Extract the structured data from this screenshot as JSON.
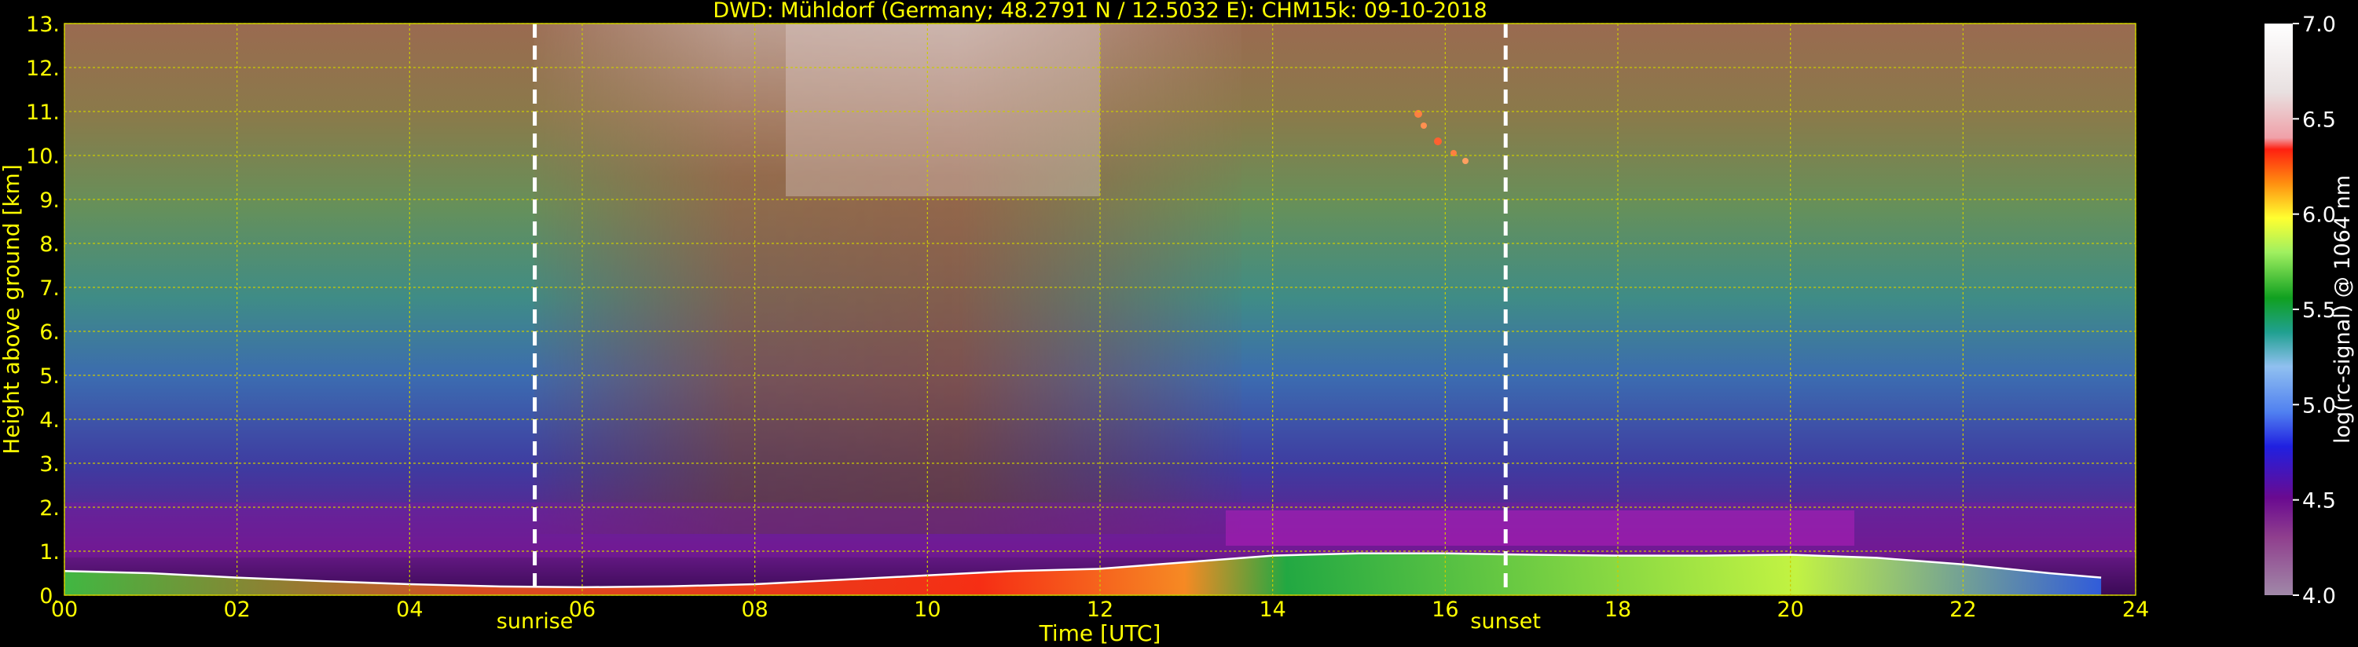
{
  "chart_data": {
    "type": "heatmap",
    "title": "DWD: Mühldorf (Germany; 48.2791 N / 12.5032 E):    CHM15k: 09-10-2018",
    "xlabel": "Time [UTC]",
    "ylabel": "Height above ground [km]",
    "xlim": [
      0,
      24
    ],
    "ylim": [
      0,
      13
    ],
    "x_ticks": [
      "00",
      "02",
      "04",
      "06",
      "08",
      "10",
      "12",
      "14",
      "16",
      "18",
      "20",
      "22",
      "24"
    ],
    "y_ticks": [
      "0.",
      "1.",
      "2.",
      "3.",
      "4.",
      "5.",
      "6.",
      "7.",
      "8.",
      "9.",
      "10.",
      "11.",
      "12.",
      "13."
    ],
    "grid": true,
    "annotations": [
      {
        "label": "sunrise",
        "time_utc": 5.45
      },
      {
        "label": "sunset",
        "time_utc": 16.7
      }
    ],
    "colorbar": {
      "label": "log(rc-signal) @ 1064 nm",
      "range": [
        4.0,
        7.0
      ],
      "ticks": [
        "4.0",
        "4.5",
        "5.0",
        "5.5",
        "6.0",
        "6.5",
        "7.0"
      ]
    },
    "boundary_layer_top_km": {
      "time_utc": [
        0,
        1,
        2,
        3,
        4,
        5,
        6,
        7,
        8,
        9,
        10,
        11,
        12,
        13,
        14,
        15,
        16,
        17,
        18,
        19,
        20,
        21,
        22,
        23,
        23.6
      ],
      "height_km": [
        0.55,
        0.5,
        0.4,
        0.32,
        0.25,
        0.2,
        0.18,
        0.2,
        0.25,
        0.35,
        0.45,
        0.55,
        0.6,
        0.75,
        0.9,
        0.95,
        0.95,
        0.92,
        0.9,
        0.9,
        0.92,
        0.85,
        0.7,
        0.5,
        0.4
      ]
    }
  },
  "colors": {
    "axis_text": "#ffff00",
    "grid": "#cccc00",
    "background": "#000000",
    "marker_line": "#ffffff"
  }
}
